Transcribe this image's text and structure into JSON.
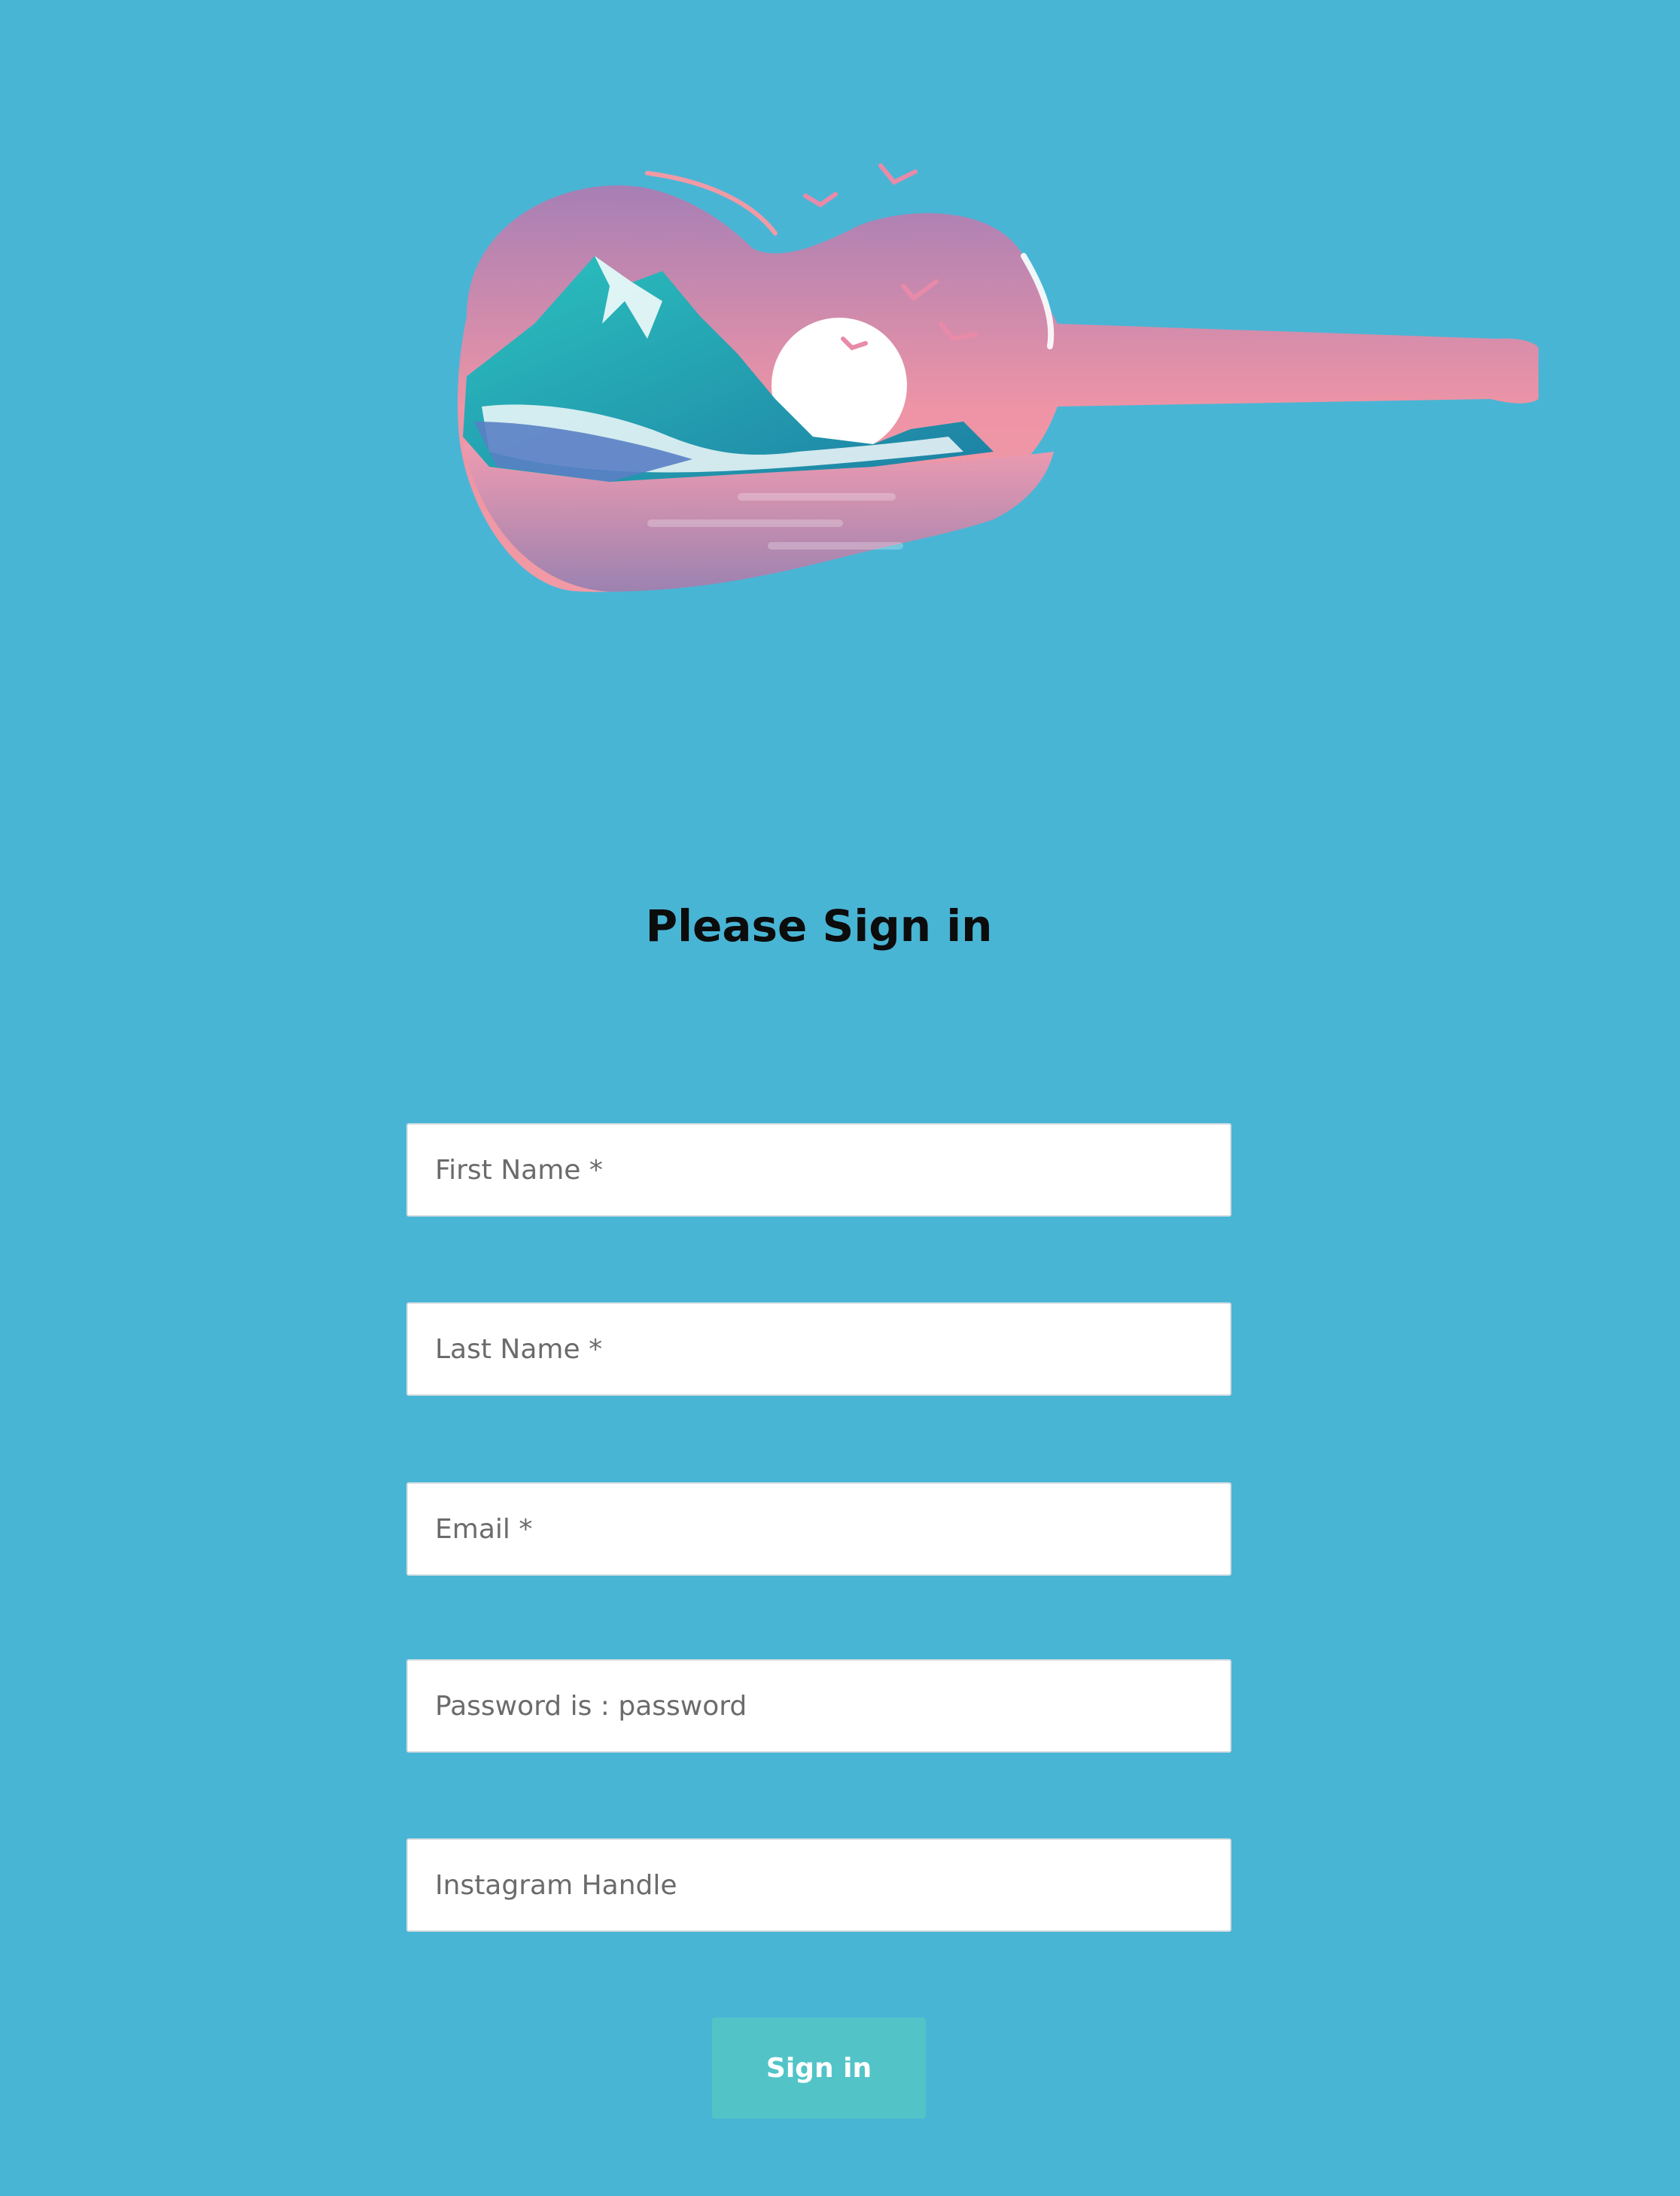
{
  "logo": {
    "icon": "guitar-landscape-logo-icon"
  },
  "heading": "Please Sign in",
  "fields": {
    "first_name_placeholder": "First Name *",
    "last_name_placeholder": "Last Name *",
    "email_placeholder": "Email *",
    "password_placeholder": "Password is : password",
    "instagram_placeholder": "Instagram Handle"
  },
  "signin_button": "Sign in",
  "colors": {
    "background": "#49b5d5",
    "button": "#52c4c8",
    "heading": "#0c0c0c"
  }
}
